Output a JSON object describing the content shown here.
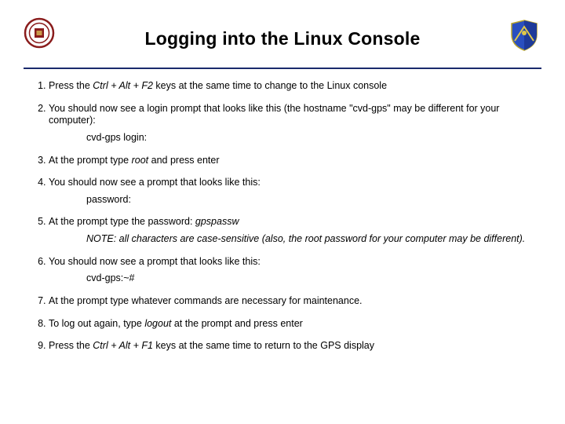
{
  "title": "Logging into the Linux Console",
  "steps": {
    "s1_a": "Press the ",
    "s1_key": "Ctrl + Alt + F2",
    "s1_b": " keys at the same time to change to the Linux console",
    "s2": "You should now see a login prompt that looks like this (the hostname \"cvd-gps\" may be different for your computer):",
    "s2_prompt": "cvd-gps login:",
    "s3_a": "At the prompt type ",
    "s3_root": "root",
    "s3_b": " and press enter",
    "s4": "You should now see a prompt that looks like this:",
    "s4_prompt": "password:",
    "s5_a": "At the prompt type the password: ",
    "s5_pw": "gpspassw",
    "s5_note": "NOTE: all characters are case-sensitive (also, the root password for your computer may be different).",
    "s6": "You should now see a prompt that looks like this:",
    "s6_prompt": "cvd-gps:~#",
    "s7": "At the prompt type whatever commands are necessary for maintenance.",
    "s8_a": "To log out again, type ",
    "s8_cmd": "logout",
    "s8_b": " at the prompt and press enter",
    "s9_a": "Press the ",
    "s9_key": "Ctrl + Alt + F1 ",
    "s9_b": " keys at the same time to return to the GPS display"
  }
}
